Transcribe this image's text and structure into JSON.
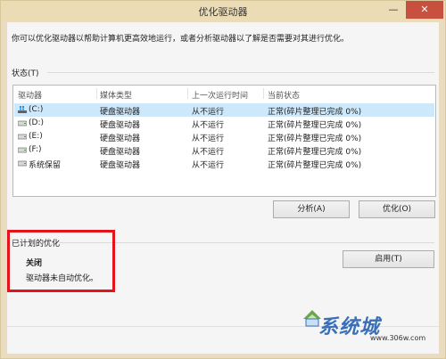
{
  "window": {
    "title": "优化驱动器",
    "minimize": "—",
    "close": "✕"
  },
  "description": "你可以优化驱动器以帮助计算机更高效地运行，或者分析驱动器以了解是否需要对其进行优化。",
  "status_label": "状态(T)",
  "table": {
    "headers": [
      "驱动器",
      "媒体类型",
      "上一次运行时间",
      "当前状态"
    ],
    "rows": [
      {
        "icon": "system-drive-icon",
        "drive": "(C:)",
        "media": "硬盘驱动器",
        "last_run": "从不运行",
        "status": "正常(碎片整理已完成 0%)",
        "selected": true
      },
      {
        "icon": "hard-drive-icon",
        "drive": "(D:)",
        "media": "硬盘驱动器",
        "last_run": "从不运行",
        "status": "正常(碎片整理已完成 0%)",
        "selected": false
      },
      {
        "icon": "hard-drive-icon",
        "drive": "(E:)",
        "media": "硬盘驱动器",
        "last_run": "从不运行",
        "status": "正常(碎片整理已完成 0%)",
        "selected": false
      },
      {
        "icon": "hard-drive-icon",
        "drive": "(F:)",
        "media": "硬盘驱动器",
        "last_run": "从不运行",
        "status": "正常(碎片整理已完成 0%)",
        "selected": false
      },
      {
        "icon": "hard-drive-icon",
        "drive": "系统保留",
        "media": "硬盘驱动器",
        "last_run": "从不运行",
        "status": "正常(碎片整理已完成 0%)",
        "selected": false
      }
    ]
  },
  "buttons": {
    "analyze": "分析(A)",
    "optimize": "优化(O)",
    "enable": "启用(T)"
  },
  "scheduled": {
    "label": "已计划的优化",
    "status": "关闭",
    "description": "驱动器未自动优化。"
  },
  "watermark": {
    "logo": "系统城",
    "url": "www.306w.com"
  },
  "colors": {
    "titlebar": "#ecdcb6",
    "close_button": "#c7503f",
    "selection": "#cde8fb",
    "annotation": "#e3121b"
  }
}
